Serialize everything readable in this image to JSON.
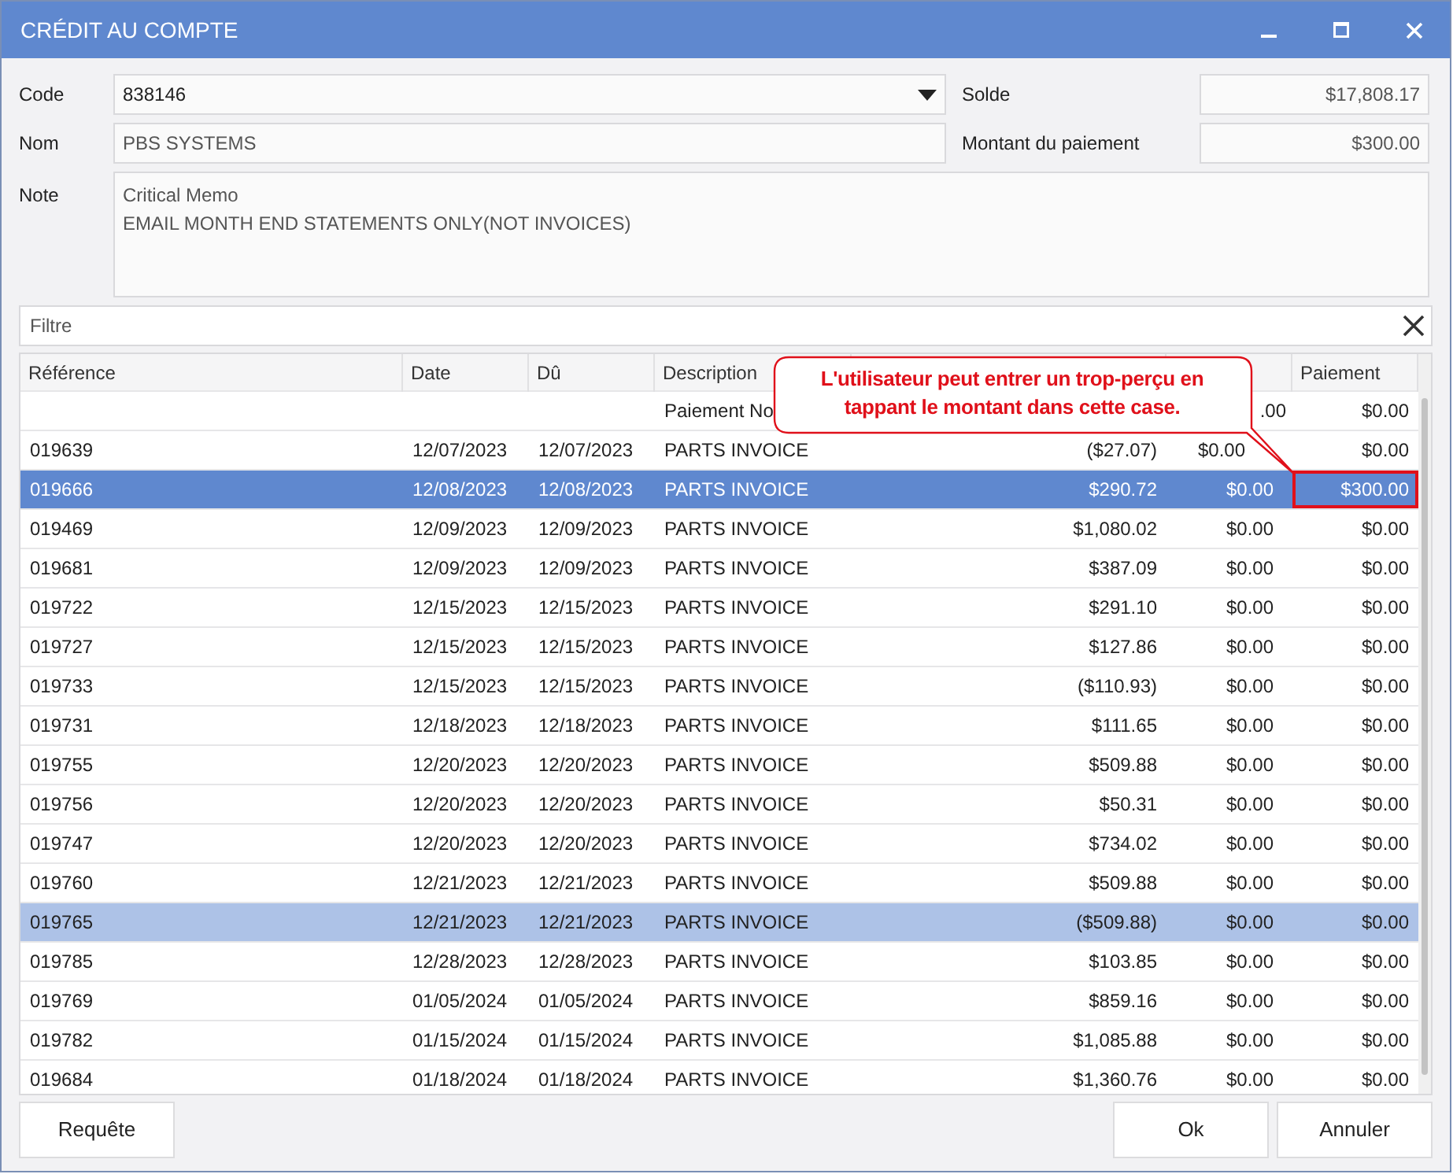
{
  "window": {
    "title": "CRÉDIT AU COMPTE"
  },
  "form": {
    "code_label": "Code",
    "code": "838146",
    "name_label": "Nom",
    "name": "PBS SYSTEMS",
    "note_label": "Note",
    "note": [
      "Critical Memo",
      "EMAIL MONTH END STATEMENTS ONLY(NOT INVOICES)"
    ],
    "balance_label": "Solde",
    "balance": "$17,808.17",
    "payment_label": "Montant du paiement",
    "payment": "$300.00"
  },
  "filter": {
    "placeholder": "Filtre"
  },
  "table": {
    "columns": [
      "Référence",
      "Date",
      "Dû",
      "Description",
      "Paiement"
    ],
    "rows": [
      {
        "description": "Paiement No",
        "column_6": ".00",
        "payment": "$0.00",
        "selected": false,
        "highlighted": false,
        "annotated": false
      },
      {
        "reference": "019639",
        "date": "12/07/2023",
        "due": "12/07/2023",
        "description": "PARTS INVOICE",
        "column_5": "($27.07)",
        "column_6": "$0.00",
        "payment": "$0.00",
        "selected": false,
        "highlighted": false,
        "annotated": false
      },
      {
        "reference": "019666",
        "date": "12/08/2023",
        "due": "12/08/2023",
        "description": "PARTS INVOICE",
        "column_5": "$290.72",
        "column_6": "$0.00",
        "payment": "$300.00",
        "selected": true,
        "highlighted": false,
        "annotated": true
      },
      {
        "reference": "019469",
        "date": "12/09/2023",
        "due": "12/09/2023",
        "description": "PARTS INVOICE",
        "column_5": "$1,080.02",
        "column_6": "$0.00",
        "payment": "$0.00",
        "selected": false,
        "highlighted": false,
        "annotated": false
      },
      {
        "reference": "019681",
        "date": "12/09/2023",
        "due": "12/09/2023",
        "description": "PARTS INVOICE",
        "column_5": "$387.09",
        "column_6": "$0.00",
        "payment": "$0.00",
        "selected": false,
        "highlighted": false,
        "annotated": false
      },
      {
        "reference": "019722",
        "date": "12/15/2023",
        "due": "12/15/2023",
        "description": "PARTS INVOICE",
        "column_5": "$291.10",
        "column_6": "$0.00",
        "payment": "$0.00",
        "selected": false,
        "highlighted": false,
        "annotated": false
      },
      {
        "reference": "019727",
        "date": "12/15/2023",
        "due": "12/15/2023",
        "description": "PARTS INVOICE",
        "column_5": "$127.86",
        "column_6": "$0.00",
        "payment": "$0.00",
        "selected": false,
        "highlighted": false,
        "annotated": false
      },
      {
        "reference": "019733",
        "date": "12/15/2023",
        "due": "12/15/2023",
        "description": "PARTS INVOICE",
        "column_5": "($110.93)",
        "column_6": "$0.00",
        "payment": "$0.00",
        "selected": false,
        "highlighted": false,
        "annotated": false
      },
      {
        "reference": "019731",
        "date": "12/18/2023",
        "due": "12/18/2023",
        "description": "PARTS INVOICE",
        "column_5": "$111.65",
        "column_6": "$0.00",
        "payment": "$0.00",
        "selected": false,
        "highlighted": false,
        "annotated": false
      },
      {
        "reference": "019755",
        "date": "12/20/2023",
        "due": "12/20/2023",
        "description": "PARTS INVOICE",
        "column_5": "$509.88",
        "column_6": "$0.00",
        "payment": "$0.00",
        "selected": false,
        "highlighted": false,
        "annotated": false
      },
      {
        "reference": "019756",
        "date": "12/20/2023",
        "due": "12/20/2023",
        "description": "PARTS INVOICE",
        "column_5": "$50.31",
        "column_6": "$0.00",
        "payment": "$0.00",
        "selected": false,
        "highlighted": false,
        "annotated": false
      },
      {
        "reference": "019747",
        "date": "12/20/2023",
        "due": "12/20/2023",
        "description": "PARTS INVOICE",
        "column_5": "$734.02",
        "column_6": "$0.00",
        "payment": "$0.00",
        "selected": false,
        "highlighted": false,
        "annotated": false
      },
      {
        "reference": "019760",
        "date": "12/21/2023",
        "due": "12/21/2023",
        "description": "PARTS INVOICE",
        "column_5": "$509.88",
        "column_6": "$0.00",
        "payment": "$0.00",
        "selected": false,
        "highlighted": false,
        "annotated": false
      },
      {
        "reference": "019765",
        "date": "12/21/2023",
        "due": "12/21/2023",
        "description": "PARTS INVOICE",
        "column_5": "($509.88)",
        "column_6": "$0.00",
        "payment": "$0.00",
        "selected": false,
        "highlighted": true,
        "annotated": false
      },
      {
        "reference": "019785",
        "date": "12/28/2023",
        "due": "12/28/2023",
        "description": "PARTS INVOICE",
        "column_5": "$103.85",
        "column_6": "$0.00",
        "payment": "$0.00",
        "selected": false,
        "highlighted": false,
        "annotated": false
      },
      {
        "reference": "019769",
        "date": "01/05/2024",
        "due": "01/05/2024",
        "description": "PARTS INVOICE",
        "column_5": "$859.16",
        "column_6": "$0.00",
        "payment": "$0.00",
        "selected": false,
        "highlighted": false,
        "annotated": false
      },
      {
        "reference": "019782",
        "date": "01/15/2024",
        "due": "01/15/2024",
        "description": "PARTS INVOICE",
        "column_5": "$1,085.88",
        "column_6": "$0.00",
        "payment": "$0.00",
        "selected": false,
        "highlighted": false,
        "annotated": false
      },
      {
        "reference": "019684",
        "date": "01/18/2024",
        "due": "01/18/2024",
        "description": "PARTS INVOICE",
        "column_5": "$1,360.76",
        "column_6": "$0.00",
        "payment": "$0.00",
        "selected": false,
        "highlighted": false,
        "annotated": false
      }
    ]
  },
  "callout": {
    "text": "L'utilisateur peut entrer un trop-perçu en tappant le montant dans cette case."
  },
  "buttons": {
    "query": "Requête",
    "ok": "Ok",
    "cancel": "Annuler"
  }
}
